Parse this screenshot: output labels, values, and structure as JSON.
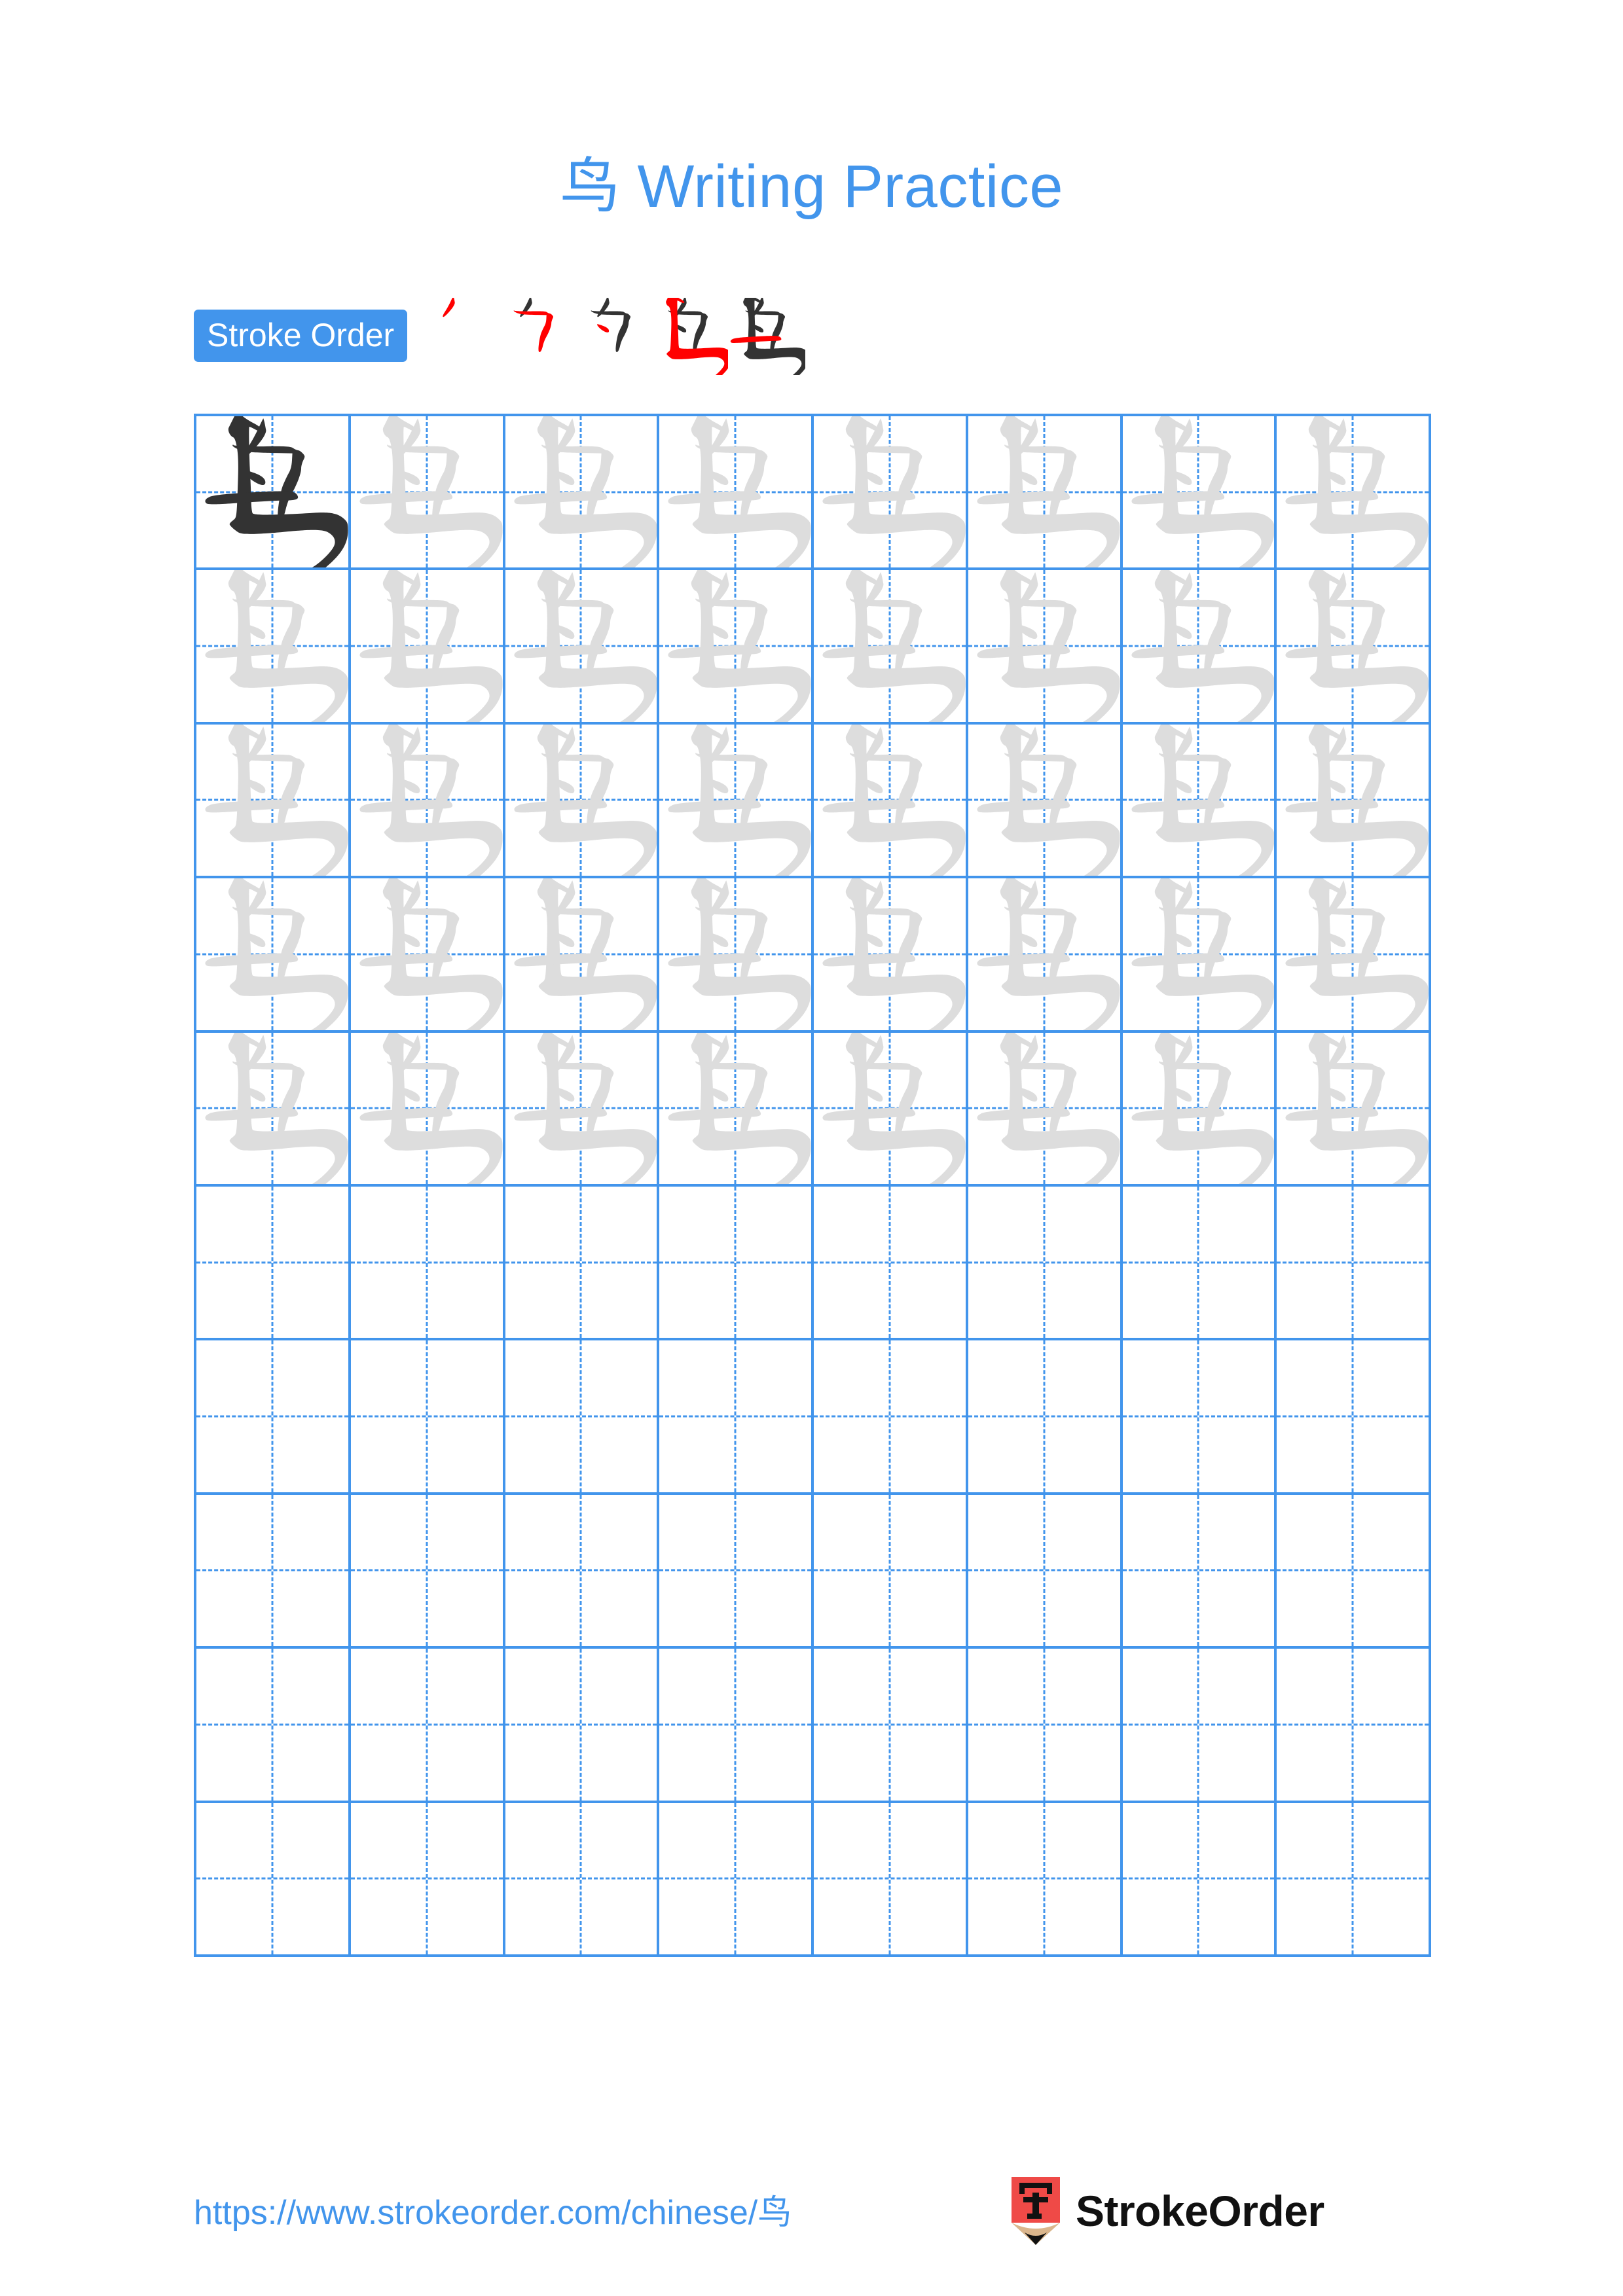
{
  "page": {
    "title": "鸟 Writing Practice",
    "character": "鸟",
    "accent_color": "#4295ec",
    "trace_color": "#dddddd",
    "ink_color": "#333333",
    "highlight_color": "#ff0000"
  },
  "stroke_order": {
    "badge_label": "Stroke Order",
    "total_strokes": 5,
    "steps": [
      {
        "index": 1,
        "new_stroke_name": "pie",
        "strokes_shown": 1
      },
      {
        "index": 2,
        "new_stroke_name": "heng-zhe",
        "strokes_shown": 2
      },
      {
        "index": 3,
        "new_stroke_name": "dian",
        "strokes_shown": 3
      },
      {
        "index": 4,
        "new_stroke_name": "heng-zhe-wan-gou",
        "strokes_shown": 4
      },
      {
        "index": 5,
        "new_stroke_name": "heng",
        "strokes_shown": 5
      }
    ]
  },
  "grid": {
    "columns": 8,
    "rows": 10,
    "filled_rows": 5,
    "first_cell_is_ink": true,
    "cell_character": "鸟"
  },
  "footer": {
    "url": "https://www.strokeorder.com/chinese/鸟",
    "brand_name": "StrokeOrder",
    "logo_character": "字",
    "logo_body_color": "#ef4a47",
    "logo_wood_color": "#dbb68c",
    "logo_tip_color": "#111111"
  }
}
